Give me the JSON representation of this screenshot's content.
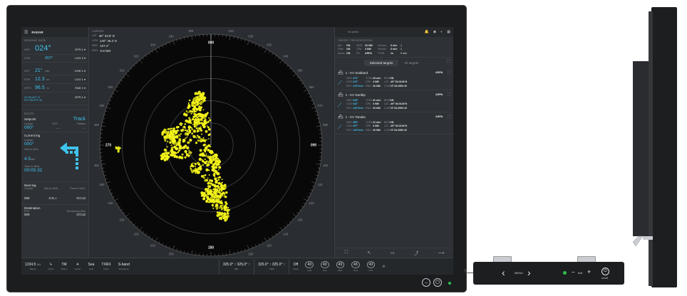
{
  "app": {
    "title": "RADAR",
    "target_search": "No alerts"
  },
  "nav": {
    "heading_label": "HEADING DATA",
    "hdg": {
      "label": "HDG",
      "value": "024°",
      "source": "GPS 1"
    },
    "stw": {
      "label": "STW",
      "value": "007°",
      "source": "LOG 2"
    },
    "rot": {
      "label": "ROT",
      "value": "21°",
      "unit": "/min",
      "source": "GHR 1"
    },
    "sog": {
      "label": "STW",
      "value": "12.3",
      "unit": "kn",
      "source": "LOG 1"
    },
    "depth": {
      "label": "DPTH",
      "value": "96.5",
      "unit": "m",
      "source": "SND 1"
    },
    "pos": {
      "lat": "41°03.447' N",
      "lon": "071°05.070' W",
      "source": "GPS 1"
    }
  },
  "route": {
    "heading_label": "ROUTE",
    "setpoint": "Setpoint",
    "mode": "Track",
    "course_label": "Course",
    "course_value": "000°",
    "rot_label": "ROT",
    "rot_value": "——",
    "radius_label": "Radius",
    "radius_value": "—",
    "current_leg": "Current leg",
    "cl_course_label": "Course",
    "cl_course_value": "000°",
    "dist_label": "Dist to WOL",
    "dist_value": "4.5",
    "dist_unit": "NM",
    "time_label": "Time to WOL",
    "time_value": "00:05:32",
    "next_leg": "Next leg",
    "nl_course_label": "Course",
    "nl_course_value": "000",
    "nl_dist_label": "Dist to WOL",
    "nl_dist_value": "0.9",
    "nl_dist_unit": "NM",
    "nl_time_label": "Time to WOL",
    "nl_time_value": "0:0:12",
    "destination": "Destination",
    "dest_eta_label": "ETA",
    "dest_eta_value": "000",
    "dest_rem_label": "Remaining time",
    "dest_rem_value": "0:0:12"
  },
  "cursor": {
    "heading": "CURSOR",
    "lat_label": "LAT",
    "lat": "36° 33.8' N",
    "lon_label": "LON",
    "lon": "140° 46.2' E",
    "brg_label": "BRG",
    "brg": "107.2°",
    "rng_label": "RNG",
    "rng": "0.8 NM"
  },
  "bearings": [
    "000",
    "010",
    "020",
    "030",
    "040",
    "050",
    "060",
    "070",
    "080",
    "090",
    "100",
    "110",
    "120",
    "130",
    "140",
    "150",
    "160",
    "170",
    "180",
    "190",
    "200",
    "210",
    "220",
    "230",
    "240",
    "250",
    "260",
    "270",
    "280",
    "290",
    "300",
    "310",
    "320",
    "330",
    "340",
    "350"
  ],
  "target_pres": {
    "heading": "TARGET PRESENTATION",
    "rows": [
      [
        "AIS",
        "ON",
        "PAST",
        "20 NM",
        "Vectors",
        "6 min",
        "1"
      ],
      [
        "Filter",
        "ON",
        "CPA",
        "4 NM",
        "Vectors",
        "6 min",
        "1"
      ],
      [
        "Assoc",
        "ON",
        "FH",
        "ARPA",
        "TCPA",
        "1s",
        "0 min"
      ]
    ]
  },
  "tabs": {
    "selected": "Selected targets",
    "all": "All targets"
  },
  "targets": [
    {
      "name": "1 - KV Svalbard",
      "tag": "ARPA",
      "hdg": "270°",
      "cog": "210°",
      "rot": "120°/min",
      "tcpa": "43 min",
      "cpa": "4 NM",
      "rng": "20 NM",
      "brg": "ON",
      "lat": "-49° 54.0149 N",
      "lon": "74° 81.0951 W"
    },
    {
      "name": "1 - KV Nordkp",
      "tag": "ARPA",
      "hdg": "045°",
      "cog": "042°",
      "rot": "120°/min",
      "tcpa": "41 min",
      "cpa": "4 NM",
      "rng": "20 NM",
      "brg": "ON",
      "lat": "-49° 54.0149 N",
      "lon": "74° 81.0951 W"
    },
    {
      "name": "1 - KV Tanaka",
      "tag": "ARPA",
      "hdg": "356°",
      "cog": "357°",
      "rot": "120°/min",
      "tcpa": "21 min",
      "cpa": "4 NM",
      "rng": "20 NM",
      "brg": "ON",
      "lat": "-49° 54.0149 N",
      "lon": "74° 81.0951 W"
    }
  ],
  "target_labels": {
    "hdg": "HDG",
    "cog": "COG",
    "rot": "ROT",
    "tcpa": "TCPA",
    "cpa": "CPA",
    "rng": "RNG",
    "brg": "BRG",
    "lat": "LAT",
    "lon": "LON"
  },
  "bottom": {
    "range_val": "1234.5",
    "range_unit": "NM",
    "range_lab": "Range",
    "orient_lab": "Orient",
    "motion_val": "TM",
    "motion_lab": "Motion",
    "center_lab": "Center",
    "sea_val": "Sea",
    "sea_lab": "Gain",
    "txrx_val": "TXRX",
    "txrx_lab": "Pulse",
    "band_val": "S-band",
    "band_lab": "Frequency",
    "ebl1": "325.0° ↑  325.0° ↑",
    "ebl1_lab": "EBL",
    "ebl2": "325.0° ↑  325.0° ↑",
    "ebl2_lab": "VRM",
    "off_val": "Off",
    "off_lab": "Head",
    "k1": "43",
    "k1_lab": "Auto",
    "k2": "43",
    "k2_lab": "Sea",
    "k3": "43",
    "k3_lab": "Rain",
    "k4": "43",
    "k4_lab": "Tune",
    "k5": "43",
    "k5_lab": "FTC"
  },
  "keypad": {
    "menu": "MENU",
    "brill": "brill",
    "onoff": "on/off"
  }
}
